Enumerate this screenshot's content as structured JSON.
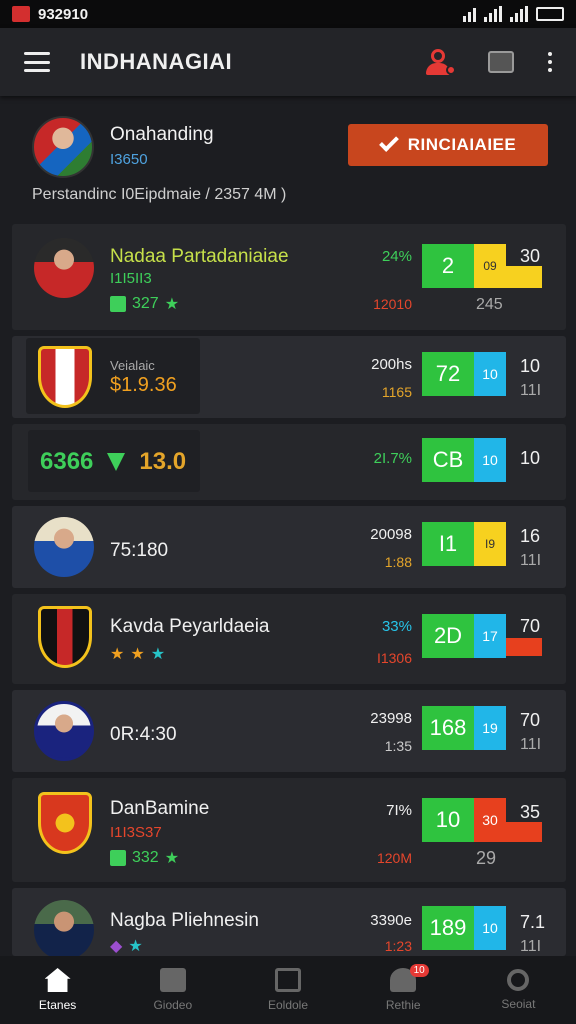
{
  "status": {
    "time": "932910"
  },
  "appbar": {
    "title": "INDHANAGIAI"
  },
  "profile": {
    "name": "Onahanding",
    "sub": "I3650",
    "button": "RINCIAIAIEE",
    "meta": "Perstandinc I0Eipdmaie  /  2357 4M  )"
  },
  "rows": [
    {
      "name": "Nadaa Partadaniaiae",
      "sub": "I1I5II3",
      "rating": "327",
      "mid_top": "24%",
      "mid_bot": "12010",
      "box1": "2",
      "box2": "09",
      "rv1": "30",
      "rv2": "245"
    },
    {
      "tag": "Veialaic",
      "score": "$1.9.36",
      "mid_top": "200hs",
      "mid_bot": "1165",
      "box1": "72",
      "box2": "10",
      "rv1": "10",
      "rv2": "11I"
    },
    {
      "left1": "6366",
      "left2": "13.0",
      "mid_top": "2I.7%",
      "box1": "CB",
      "box2": "10",
      "rv1": "10"
    },
    {
      "time": "75:180",
      "mid_top": "20098",
      "mid_bot": "1:88",
      "box1": "I1",
      "box2": "I9",
      "rv1": "16",
      "rv2": "11I"
    },
    {
      "name": "Kavda Peyarldaeia",
      "mid_top": "33%",
      "mid_bot": "I1306",
      "box1": "2D",
      "box2": "17",
      "rv1": "70"
    },
    {
      "time": "0R:4:30",
      "mid_top": "23998",
      "mid_bot": "1:35",
      "box1": "168",
      "box2": "19",
      "rv1": "70",
      "rv2": "11I"
    },
    {
      "name": "DanBamine",
      "sub": "I1I3S37",
      "rating": "332",
      "mid_top": "7I%",
      "mid_bot": "120M",
      "box1": "10",
      "box2": "30",
      "rv1": "35",
      "rv2": "29"
    },
    {
      "name": "Nagba Pliehnesin",
      "mid_top": "3390e",
      "mid_bot": "1:23",
      "box1": "189",
      "box2": "10",
      "rv1": "7.1",
      "rv2": "11I"
    }
  ],
  "nav": [
    {
      "label": "Etanes"
    },
    {
      "label": "Giodeo"
    },
    {
      "label": "Eoldole"
    },
    {
      "label": "Rethie",
      "badge": "10"
    },
    {
      "label": "Seoiat"
    }
  ],
  "colors": {
    "accent": "#c8461e",
    "green": "#2fc33f",
    "cyan": "#21b6e8",
    "yellow": "#f7d11f",
    "red": "#e7401e"
  }
}
